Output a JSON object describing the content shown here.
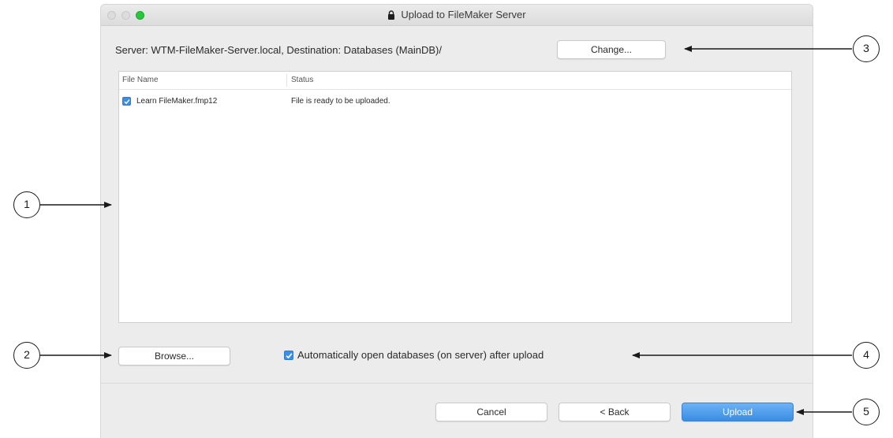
{
  "window": {
    "title": "Upload to FileMaker Server"
  },
  "server_line": "Server: WTM-FileMaker-Server.local, Destination: Databases (MainDB)/",
  "buttons": {
    "change": "Change...",
    "browse": "Browse...",
    "cancel": "Cancel",
    "back": "< Back",
    "upload": "Upload"
  },
  "table": {
    "headers": [
      "File Name",
      "Status"
    ],
    "rows": [
      {
        "checked": true,
        "file_name": "Learn FileMaker.fmp12",
        "status": "File is ready to be uploaded."
      }
    ]
  },
  "auto_open": {
    "checked": true,
    "label": "Automatically open databases (on server) after upload"
  },
  "callouts": [
    "1",
    "2",
    "3",
    "4",
    "5"
  ],
  "colors": {
    "accent": "#3a8de4",
    "close_light": "#28c83e",
    "window_bg": "#ececec"
  },
  "icons": [
    "lock-icon",
    "checkmark-icon",
    "arrow-icon"
  ]
}
